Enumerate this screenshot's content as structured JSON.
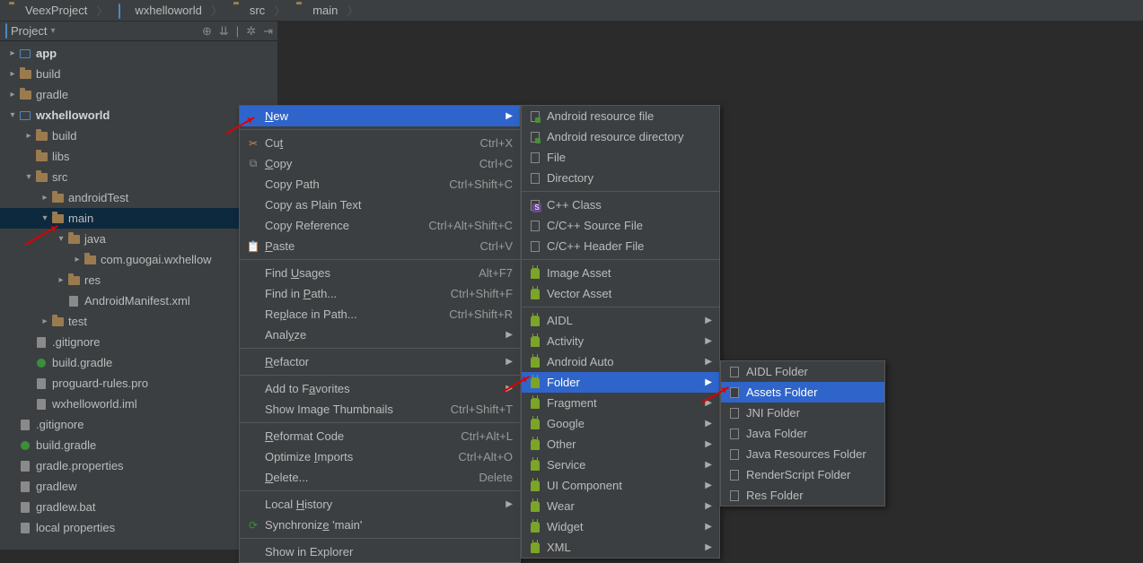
{
  "breadcrumb": [
    {
      "label": "VeexProject",
      "icon": "folder"
    },
    {
      "label": "wxhelloworld",
      "icon": "module"
    },
    {
      "label": "src",
      "icon": "folder"
    },
    {
      "label": "main",
      "icon": "folder"
    }
  ],
  "tool_header": {
    "title": "Project"
  },
  "tree": [
    {
      "indent": 0,
      "arrow": "right",
      "icon": "module",
      "label": "app",
      "bold": true
    },
    {
      "indent": 0,
      "arrow": "right",
      "icon": "folder",
      "label": "build"
    },
    {
      "indent": 0,
      "arrow": "right",
      "icon": "folder",
      "label": "gradle"
    },
    {
      "indent": 0,
      "arrow": "down",
      "icon": "module",
      "label": "wxhelloworld",
      "bold": true
    },
    {
      "indent": 1,
      "arrow": "right",
      "icon": "folder",
      "label": "build"
    },
    {
      "indent": 1,
      "arrow": "",
      "icon": "folder",
      "label": "libs"
    },
    {
      "indent": 1,
      "arrow": "down",
      "icon": "folder",
      "label": "src"
    },
    {
      "indent": 2,
      "arrow": "right",
      "icon": "folder",
      "label": "androidTest"
    },
    {
      "indent": 2,
      "arrow": "down",
      "icon": "folder",
      "label": "main",
      "selected": true
    },
    {
      "indent": 3,
      "arrow": "down",
      "icon": "folder",
      "label": "java"
    },
    {
      "indent": 4,
      "arrow": "right",
      "icon": "folder",
      "label": "com.guogai.wxhellow"
    },
    {
      "indent": 3,
      "arrow": "right",
      "icon": "folder",
      "label": "res"
    },
    {
      "indent": 3,
      "arrow": "",
      "icon": "file",
      "label": "AndroidManifest.xml"
    },
    {
      "indent": 2,
      "arrow": "right",
      "icon": "folder",
      "label": "test"
    },
    {
      "indent": 1,
      "arrow": "",
      "icon": "file",
      "label": ".gitignore"
    },
    {
      "indent": 1,
      "arrow": "",
      "icon": "gradle",
      "label": "build.gradle"
    },
    {
      "indent": 1,
      "arrow": "",
      "icon": "file",
      "label": "proguard-rules.pro"
    },
    {
      "indent": 1,
      "arrow": "",
      "icon": "file",
      "label": "wxhelloworld.iml"
    },
    {
      "indent": 0,
      "arrow": "",
      "icon": "file",
      "label": ".gitignore"
    },
    {
      "indent": 0,
      "arrow": "",
      "icon": "gradle",
      "label": "build.gradle"
    },
    {
      "indent": 0,
      "arrow": "",
      "icon": "file",
      "label": "gradle.properties"
    },
    {
      "indent": 0,
      "arrow": "",
      "icon": "file",
      "label": "gradlew"
    },
    {
      "indent": 0,
      "arrow": "",
      "icon": "file",
      "label": "gradlew.bat"
    },
    {
      "indent": 0,
      "arrow": "",
      "icon": "file",
      "label": "local properties"
    }
  ],
  "menu1": [
    {
      "type": "item",
      "label": "New",
      "u": 0,
      "sub": true,
      "selected": true
    },
    {
      "type": "sep"
    },
    {
      "type": "item",
      "icon": "cut",
      "label": "Cut",
      "u": 2,
      "shortcut": "Ctrl+X"
    },
    {
      "type": "item",
      "icon": "copy",
      "label": "Copy",
      "u": 0,
      "shortcut": "Ctrl+C"
    },
    {
      "type": "item",
      "label": "Copy Path",
      "shortcut": "Ctrl+Shift+C"
    },
    {
      "type": "item",
      "label": "Copy as Plain Text"
    },
    {
      "type": "item",
      "label": "Copy Reference",
      "shortcut": "Ctrl+Alt+Shift+C"
    },
    {
      "type": "item",
      "icon": "paste",
      "label": "Paste",
      "u": 0,
      "shortcut": "Ctrl+V"
    },
    {
      "type": "sep"
    },
    {
      "type": "item",
      "label": "Find Usages",
      "u": 5,
      "shortcut": "Alt+F7"
    },
    {
      "type": "item",
      "label": "Find in Path...",
      "u": 8,
      "shortcut": "Ctrl+Shift+F"
    },
    {
      "type": "item",
      "label": "Replace in Path...",
      "u": 2,
      "shortcut": "Ctrl+Shift+R"
    },
    {
      "type": "item",
      "label": "Analyze",
      "u": 4,
      "sub": true
    },
    {
      "type": "sep"
    },
    {
      "type": "item",
      "label": "Refactor",
      "u": 0,
      "sub": true
    },
    {
      "type": "sep"
    },
    {
      "type": "item",
      "label": "Add to Favorites",
      "u": 8,
      "sub": true
    },
    {
      "type": "item",
      "label": "Show Image Thumbnails",
      "shortcut": "Ctrl+Shift+T"
    },
    {
      "type": "sep"
    },
    {
      "type": "item",
      "label": "Reformat Code",
      "u": 0,
      "shortcut": "Ctrl+Alt+L"
    },
    {
      "type": "item",
      "label": "Optimize Imports",
      "u": 9,
      "shortcut": "Ctrl+Alt+O"
    },
    {
      "type": "item",
      "label": "Delete...",
      "u": 0,
      "shortcut": "Delete"
    },
    {
      "type": "sep"
    },
    {
      "type": "item",
      "label": "Local History",
      "u": 6,
      "sub": true
    },
    {
      "type": "item",
      "icon": "sync",
      "label": "Synchronize 'main'",
      "u": 10
    },
    {
      "type": "sep"
    },
    {
      "type": "item",
      "label": "Show in Explorer"
    }
  ],
  "menu2": [
    {
      "type": "item",
      "icon": "doc-green",
      "label": "Android resource file"
    },
    {
      "type": "item",
      "icon": "doc-green",
      "label": "Android resource directory"
    },
    {
      "type": "item",
      "icon": "doc",
      "label": "File"
    },
    {
      "type": "item",
      "icon": "doc",
      "label": "Directory"
    },
    {
      "type": "sep"
    },
    {
      "type": "item",
      "icon": "doc-cpp",
      "label": "C++ Class"
    },
    {
      "type": "item",
      "icon": "doc",
      "label": "C/C++ Source File"
    },
    {
      "type": "item",
      "icon": "doc",
      "label": "C/C++ Header File"
    },
    {
      "type": "sep"
    },
    {
      "type": "item",
      "icon": "android",
      "label": "Image Asset"
    },
    {
      "type": "item",
      "icon": "android",
      "label": "Vector Asset"
    },
    {
      "type": "sep"
    },
    {
      "type": "item",
      "icon": "android",
      "label": "AIDL",
      "sub": true
    },
    {
      "type": "item",
      "icon": "android",
      "label": "Activity",
      "sub": true
    },
    {
      "type": "item",
      "icon": "android",
      "label": "Android Auto",
      "sub": true
    },
    {
      "type": "item",
      "icon": "android",
      "label": "Folder",
      "sub": true,
      "selected": true
    },
    {
      "type": "item",
      "icon": "android",
      "label": "Fragment",
      "sub": true
    },
    {
      "type": "item",
      "icon": "android",
      "label": "Google",
      "sub": true
    },
    {
      "type": "item",
      "icon": "android",
      "label": "Other",
      "sub": true
    },
    {
      "type": "item",
      "icon": "android",
      "label": "Service",
      "sub": true
    },
    {
      "type": "item",
      "icon": "android",
      "label": "UI Component",
      "sub": true
    },
    {
      "type": "item",
      "icon": "android",
      "label": "Wear",
      "sub": true
    },
    {
      "type": "item",
      "icon": "android",
      "label": "Widget",
      "sub": true
    },
    {
      "type": "item",
      "icon": "android",
      "label": "XML",
      "sub": true
    }
  ],
  "menu3": [
    {
      "type": "item",
      "icon": "doc",
      "label": "AIDL Folder"
    },
    {
      "type": "item",
      "icon": "doc",
      "label": "Assets Folder",
      "selected": true
    },
    {
      "type": "item",
      "icon": "doc",
      "label": "JNI Folder"
    },
    {
      "type": "item",
      "icon": "doc",
      "label": "Java Folder"
    },
    {
      "type": "item",
      "icon": "doc",
      "label": "Java Resources Folder"
    },
    {
      "type": "item",
      "icon": "doc",
      "label": "RenderScript Folder"
    },
    {
      "type": "item",
      "icon": "doc",
      "label": "Res Folder"
    }
  ]
}
